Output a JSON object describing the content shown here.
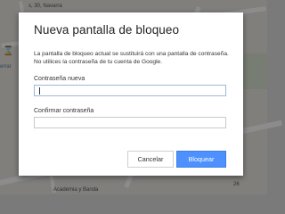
{
  "background_map": {
    "sidebar_label": "errar",
    "address_text": "s, 30, Navarra",
    "street_label": "Academia y Banda",
    "house_number": "26"
  },
  "dialog": {
    "title": "Nueva pantalla de bloqueo",
    "description": "La pantalla de bloqueo actual se sustituirá con una pantalla de contraseña. No utilices la contraseña de tu cuenta de Google.",
    "new_password_label": "Contraseña nueva",
    "new_password_value": "",
    "confirm_password_label": "Confirmar contraseña",
    "confirm_password_value": "",
    "cancel_label": "Cancelar",
    "confirm_label": "Bloquear"
  },
  "colors": {
    "primary_button": "#4d90fe",
    "overlay": "#7a7a7a",
    "dialog_bg": "#ffffff"
  }
}
